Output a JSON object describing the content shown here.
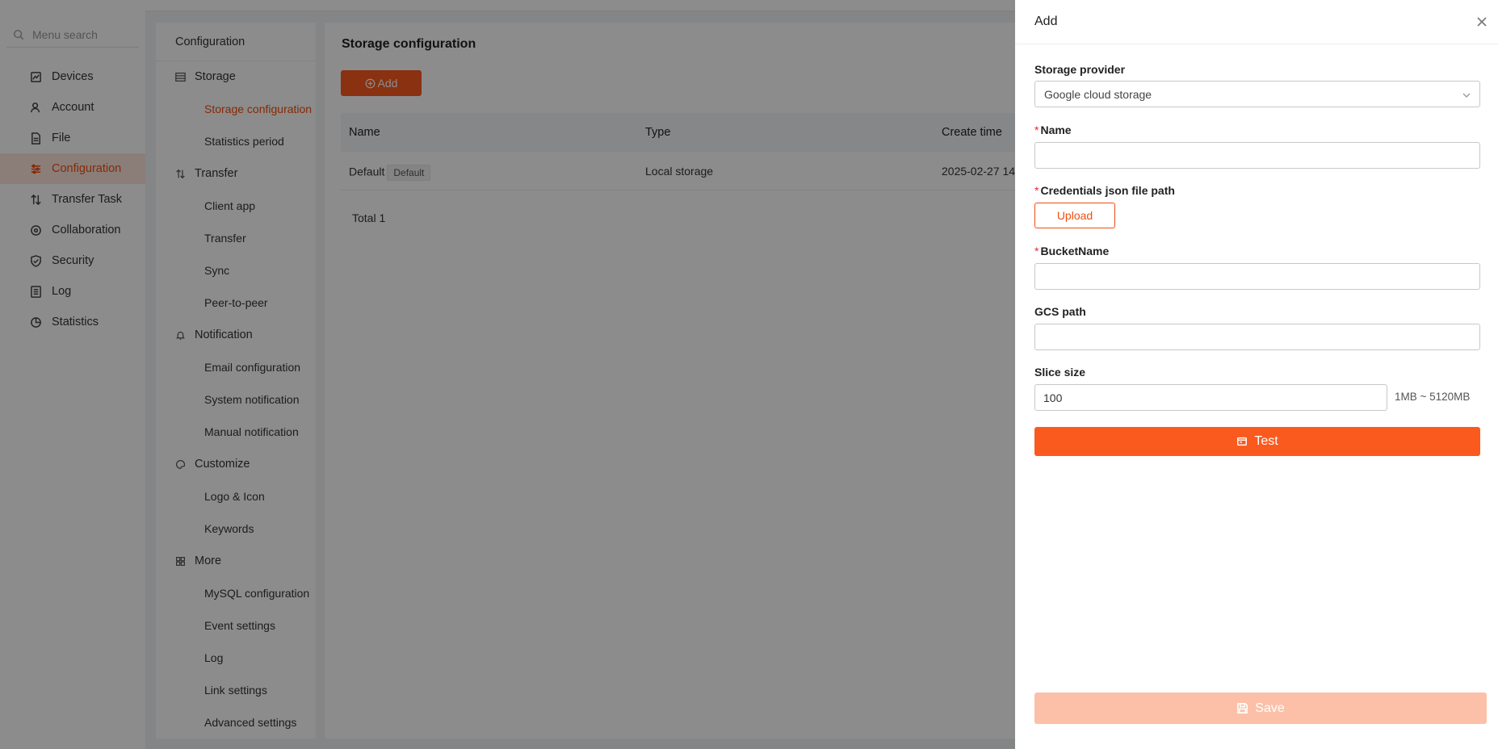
{
  "menu": {
    "search_placeholder": "Menu search",
    "items": [
      {
        "label": "Devices",
        "icon": "devices-icon"
      },
      {
        "label": "Account",
        "icon": "account-icon"
      },
      {
        "label": "File",
        "icon": "file-icon"
      },
      {
        "label": "Configuration",
        "icon": "configuration-icon",
        "active": true
      },
      {
        "label": "Transfer Task",
        "icon": "transfer-task-icon"
      },
      {
        "label": "Collaboration",
        "icon": "collaboration-icon"
      },
      {
        "label": "Security",
        "icon": "security-icon"
      },
      {
        "label": "Log",
        "icon": "log-icon"
      },
      {
        "label": "Statistics",
        "icon": "statistics-icon"
      }
    ]
  },
  "subnav": {
    "title": "Configuration",
    "groups": [
      {
        "label": "Storage",
        "icon": "storage-icon",
        "items": [
          "Storage configuration",
          "Statistics period"
        ]
      },
      {
        "label": "Transfer",
        "icon": "transfer-icon",
        "items": [
          "Client app",
          "Transfer",
          "Sync",
          "Peer-to-peer"
        ]
      },
      {
        "label": "Notification",
        "icon": "bell-icon",
        "items": [
          "Email configuration",
          "System notification",
          "Manual notification"
        ]
      },
      {
        "label": "Customize",
        "icon": "palette-icon",
        "items": [
          "Logo & Icon",
          "Keywords"
        ]
      },
      {
        "label": "More",
        "icon": "grid-icon",
        "items": [
          "MySQL configuration",
          "Event settings",
          "Log",
          "Link settings",
          "Advanced settings"
        ]
      }
    ],
    "active_item": "Storage configuration"
  },
  "content": {
    "title": "Storage configuration",
    "add_label": "Add",
    "columns": [
      "Name",
      "Type",
      "Create time"
    ],
    "rows": [
      {
        "name": "Default",
        "tag": "Default",
        "type": "Local storage",
        "create_time": "2025-02-27 14:"
      }
    ],
    "total": "Total 1"
  },
  "drawer": {
    "title": "Add",
    "provider_label": "Storage provider",
    "provider_value": "Google cloud storage",
    "name_label": "Name",
    "name_value": "",
    "credentials_label": "Credentials json file path",
    "upload_label": "Upload",
    "bucket_label": "BucketName",
    "bucket_value": "",
    "gcs_label": "GCS path",
    "gcs_value": "",
    "slice_label": "Slice size",
    "slice_value": "100",
    "slice_hint": "1MB ~ 5120MB",
    "test_label": "Test",
    "save_label": "Save",
    "required_mark": "*"
  },
  "colors": {
    "accent": "#fa5a1e",
    "accent_text": "#f04e0e",
    "save_disabled": "#fcc0a8"
  }
}
